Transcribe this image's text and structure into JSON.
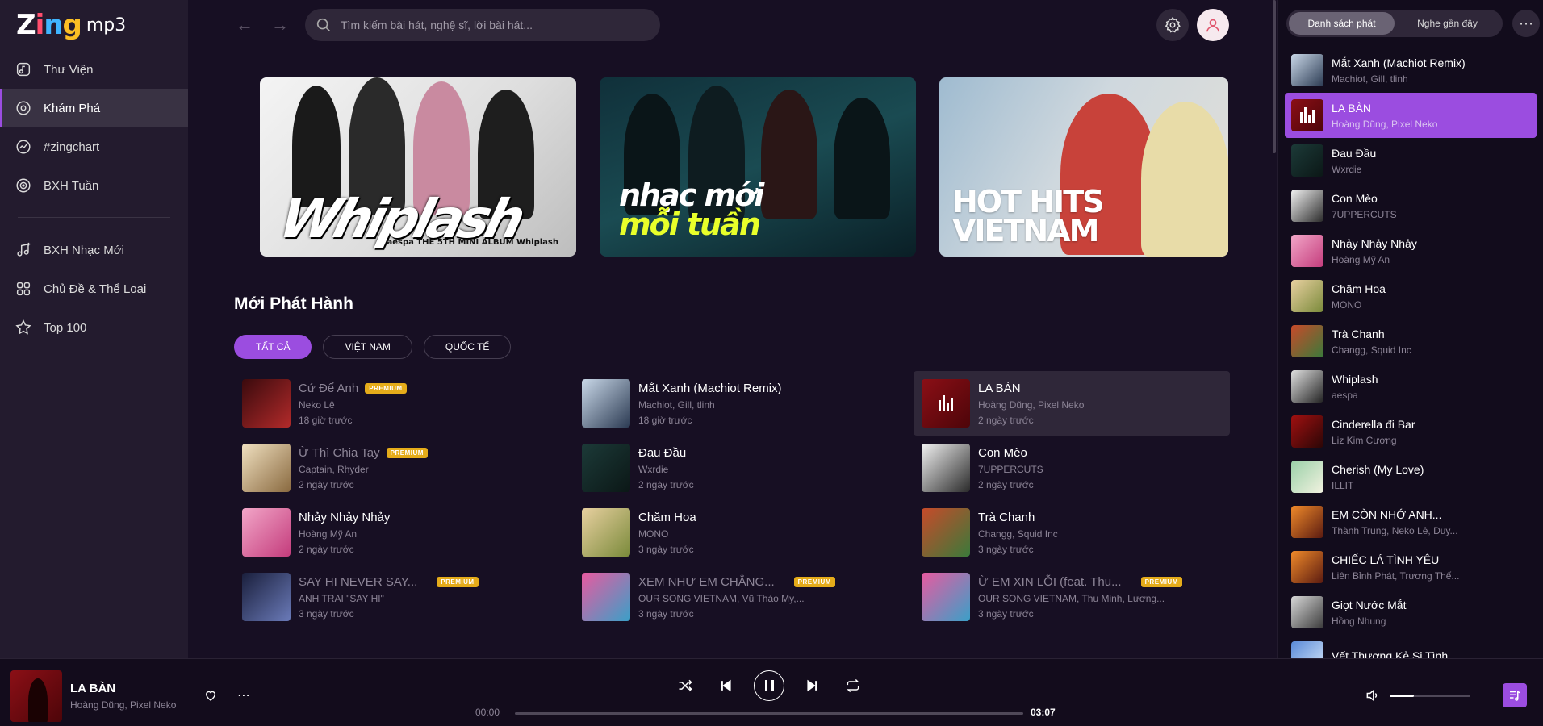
{
  "logo": {
    "zing": [
      "Z",
      "i",
      "n",
      "g"
    ],
    "mp3": "mp3"
  },
  "sidebar": {
    "items": [
      {
        "label": "Thư Viện",
        "icon": "library-icon",
        "active": false
      },
      {
        "label": "Khám Phá",
        "icon": "discover-icon",
        "active": true
      },
      {
        "label": "#zingchart",
        "icon": "chart-icon",
        "active": false
      },
      {
        "label": "BXH Tuần",
        "icon": "radio-icon",
        "active": false
      }
    ],
    "items2": [
      {
        "label": "BXH Nhạc Mới",
        "icon": "new-music-icon"
      },
      {
        "label": "Chủ Đề & Thể Loại",
        "icon": "category-icon"
      },
      {
        "label": "Top 100",
        "icon": "star-icon"
      }
    ]
  },
  "header": {
    "search_placeholder": "Tìm kiếm bài hát, nghệ sĩ, lời bài hát..."
  },
  "banners": [
    {
      "name": "whiplash-banner",
      "text": "Whiplash",
      "sub": "aespa THE 5TH MINI ALBUM Whiplash"
    },
    {
      "name": "nhac-moi-banner",
      "line1": "nhạc mới",
      "line2": "mỗi tuần"
    },
    {
      "name": "hot-hits-banner",
      "line1": "HOT HITS",
      "line2": "VIETNAM"
    }
  ],
  "section": {
    "title": "Mới Phát Hành",
    "chips": [
      "TẤT CẢ",
      "VIỆT NAM",
      "QUỐC TẾ"
    ]
  },
  "premium_label": "PREMIUM",
  "releases": [
    [
      {
        "title": "Cứ Để Anh",
        "artist": "Neko Lê",
        "time": "18 giờ trước",
        "premium": true,
        "dim": true,
        "colors": [
          "#3a0a0d",
          "#b22a2a"
        ]
      },
      {
        "title": "Ừ Thì Chia Tay",
        "artist": "Captain, Rhyder",
        "time": "2 ngày trước",
        "premium": true,
        "dim": true,
        "colors": [
          "#f0e0c0",
          "#8a6a40"
        ]
      },
      {
        "title": "Nhảy Nhảy Nhảy",
        "artist": "Hoàng Mỹ An",
        "time": "2 ngày trước",
        "premium": false,
        "dim": false,
        "colors": [
          "#f2a6c8",
          "#c43c7c"
        ]
      },
      {
        "title": "SAY HI NEVER SAY...",
        "artist": "ANH TRAI \"SAY HI\"",
        "time": "3 ngày trước",
        "premium": true,
        "dim": true,
        "colors": [
          "#1a1f3c",
          "#6a7ab8"
        ]
      }
    ],
    [
      {
        "title": "Mắt Xanh (Machiot Remix)",
        "artist": "Machiot, Gill, tlinh",
        "time": "18 giờ trước",
        "premium": false,
        "dim": false,
        "colors": [
          "#c9d8e8",
          "#2b3a52"
        ]
      },
      {
        "title": "Đau Đầu",
        "artist": "Wxrdie",
        "time": "2 ngày trước",
        "premium": false,
        "dim": false,
        "colors": [
          "#1c3a38",
          "#0b1716"
        ]
      },
      {
        "title": "Chăm Hoa",
        "artist": "MONO",
        "time": "3 ngày trước",
        "premium": false,
        "dim": false,
        "colors": [
          "#e8d0a0",
          "#7a8a3a"
        ]
      },
      {
        "title": "XEM NHƯ EM CHẲNG...",
        "artist": "OUR SONG VIETNAM, Vũ Thảo My,...",
        "time": "3 ngày trước",
        "premium": true,
        "dim": true,
        "colors": [
          "#e85aa0",
          "#3aa0c8"
        ]
      }
    ],
    [
      {
        "title": "LA BÀN",
        "artist": "Hoàng Dũng, Pixel Neko",
        "time": "2 ngày trước",
        "premium": false,
        "dim": false,
        "playing": true,
        "colors": [
          "#8b0f16",
          "#4d0509"
        ]
      },
      {
        "title": "Con Mèo",
        "artist": "7UPPERCUTS",
        "time": "2 ngày trước",
        "premium": false,
        "dim": false,
        "colors": [
          "#f2f2f2",
          "#2a2a2a"
        ]
      },
      {
        "title": "Trà Chanh",
        "artist": "Changg, Squid Inc",
        "time": "3 ngày trước",
        "premium": false,
        "dim": false,
        "colors": [
          "#c84a2a",
          "#3a7a3a"
        ]
      },
      {
        "title": "Ừ EM XIN LỖI (feat. Thu...",
        "artist": "OUR SONG VIETNAM, Thu Minh, Lương...",
        "time": "3 ngày trước",
        "premium": true,
        "dim": true,
        "colors": [
          "#e85aa0",
          "#3aa0c8"
        ]
      }
    ]
  ],
  "queue": {
    "tabs": [
      "Danh sách phát",
      "Nghe gần đây"
    ],
    "items": [
      {
        "title": "Mắt Xanh (Machiot Remix)",
        "artist": "Machiot, Gill, tlinh",
        "colors": [
          "#c9d8e8",
          "#2b3a52"
        ]
      },
      {
        "title": "LA BÀN",
        "artist": "Hoàng Dũng, Pixel Neko",
        "active": true,
        "colors": [
          "#8b0f16",
          "#4d0509"
        ]
      },
      {
        "title": "Đau Đầu",
        "artist": "Wxrdie",
        "colors": [
          "#1c3a38",
          "#0b1716"
        ]
      },
      {
        "title": "Con Mèo",
        "artist": "7UPPERCUTS",
        "colors": [
          "#f2f2f2",
          "#2a2a2a"
        ]
      },
      {
        "title": "Nhảy Nhảy Nhảy",
        "artist": "Hoàng Mỹ An",
        "colors": [
          "#f2a6c8",
          "#c43c7c"
        ]
      },
      {
        "title": "Chăm Hoa",
        "artist": "MONO",
        "colors": [
          "#e8d0a0",
          "#7a8a3a"
        ]
      },
      {
        "title": "Trà Chanh",
        "artist": "Changg, Squid Inc",
        "colors": [
          "#c84a2a",
          "#3a7a3a"
        ]
      },
      {
        "title": "Whiplash",
        "artist": "aespa",
        "colors": [
          "#e0e0e0",
          "#222222"
        ]
      },
      {
        "title": "Cinderella đi Bar",
        "artist": "Liz Kim Cương",
        "colors": [
          "#a01010",
          "#2a0606"
        ]
      },
      {
        "title": "Cherish (My Love)",
        "artist": "ILLIT",
        "colors": [
          "#9ad0a8",
          "#f2f2e0"
        ]
      },
      {
        "title": "EM CÒN NHỚ ANH...",
        "artist": "Thành Trung, Neko Lê, Duy...",
        "colors": [
          "#f08a2a",
          "#5a1a10"
        ]
      },
      {
        "title": "CHIẾC LÁ TÌNH YÊU",
        "artist": "Liên Bỉnh Phát, Trương Thế...",
        "colors": [
          "#f08a2a",
          "#5a1a10"
        ]
      },
      {
        "title": "Giọt Nước Mắt",
        "artist": "Hồng Nhung",
        "colors": [
          "#d8d8d8",
          "#3a3a3a"
        ]
      },
      {
        "title": "Vết Thương Kẻ Si Tình",
        "artist": "",
        "colors": [
          "#5a8ad8",
          "#d8e8f8"
        ]
      }
    ]
  },
  "player": {
    "title": "LA BÀN",
    "artist": "Hoàng Dũng, Pixel Neko",
    "time_current": "00:00",
    "time_total": "03:07",
    "progress": 0,
    "volume": 0.3
  },
  "colors": {
    "accent": "#9b4de0",
    "background": "#170f23",
    "sidebar": "#231b2e",
    "premium": "#e5ac1a"
  }
}
